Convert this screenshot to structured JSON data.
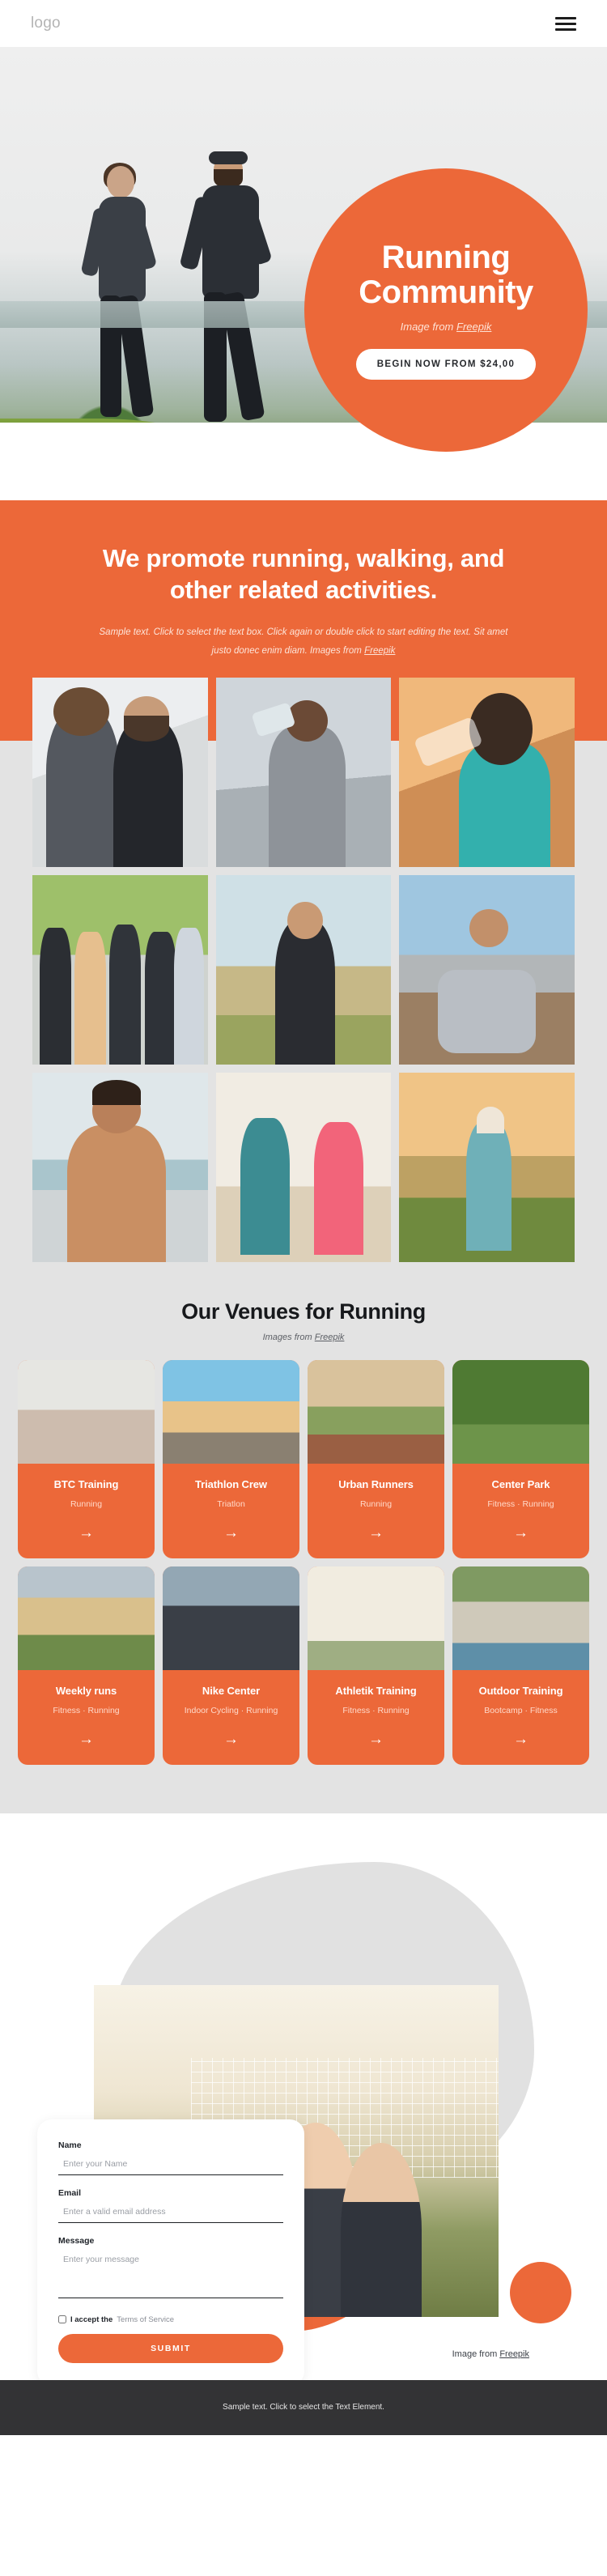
{
  "header": {
    "logo": "logo",
    "menu_icon": "hamburger-menu-icon"
  },
  "hero": {
    "title_line1": "Running",
    "title_line2": "Community",
    "credit_prefix": "Image from ",
    "credit_link": "Freepik",
    "cta_label": "BEGIN NOW FROM $24,00",
    "circle_color": "#ec6839"
  },
  "promo": {
    "heading": "We promote running, walking, and other related activities.",
    "body_prefix": "Sample text. Click to select the text box. Click again or double click to start editing the text. Sit amet justo donec enim diam. Images from ",
    "body_link": "Freepik",
    "background": "#ec6839"
  },
  "gallery": {
    "items": [
      {
        "alt": "two-runners-with-headphones"
      },
      {
        "alt": "man-drinking-water-on-bridge"
      },
      {
        "alt": "woman-drinking-water-bottle"
      },
      {
        "alt": "group-of-friends-hands-together"
      },
      {
        "alt": "woman-running-in-field"
      },
      {
        "alt": "man-at-starting-line-on-boardwalk"
      },
      {
        "alt": "shirtless-man-by-the-sea"
      },
      {
        "alt": "two-women-jogging-on-beach"
      },
      {
        "alt": "man-running-at-sunset-by-lake"
      }
    ]
  },
  "venues": {
    "heading": "Our Venues for Running",
    "sub_prefix": "Images from ",
    "sub_link": "Freepik",
    "arrow_icon": "arrow-right-icon",
    "cards": [
      {
        "name": "BTC Training",
        "tags": "Running",
        "thumb": "couple-running-on-bridge"
      },
      {
        "name": "Triathlon Crew",
        "tags": "Triatlon",
        "thumb": "four-athletes-at-sunset"
      },
      {
        "name": "Urban Runners",
        "tags": "Running",
        "thumb": "sprinters-on-track"
      },
      {
        "name": "Center Park",
        "tags": "Fitness · Running",
        "thumb": "couple-jogging-in-park"
      },
      {
        "name": "Weekly runs",
        "tags": "Fitness · Running",
        "thumb": "group-running-up-stairs"
      },
      {
        "name": "Nike Center",
        "tags": "Indoor Cycling · Running",
        "thumb": "spin-class-indoor-cycling"
      },
      {
        "name": "Athletik Training",
        "tags": "Fitness · Running",
        "thumb": "two-women-jumping-high-five"
      },
      {
        "name": "Outdoor Training",
        "tags": "Bootcamp · Fitness",
        "thumb": "couple-stretching-outdoors"
      }
    ]
  },
  "contact": {
    "photo_alt": "three-women-taking-selfie-at-volleyball-net",
    "fields": [
      {
        "label": "Name",
        "placeholder": "Enter your Name",
        "value": ""
      },
      {
        "label": "Email",
        "placeholder": "Enter a valid email address",
        "value": ""
      },
      {
        "label": "Message",
        "placeholder": "Enter your message",
        "value": ""
      }
    ],
    "terms_prefix": "I accept the ",
    "terms_link": "Terms of Service",
    "submit_label": "SUBMIT",
    "credit_prefix": "Image from ",
    "credit_link": "Freepik"
  },
  "footer": {
    "text": "Sample text. Click to select the Text Element.",
    "background": "#333335"
  }
}
